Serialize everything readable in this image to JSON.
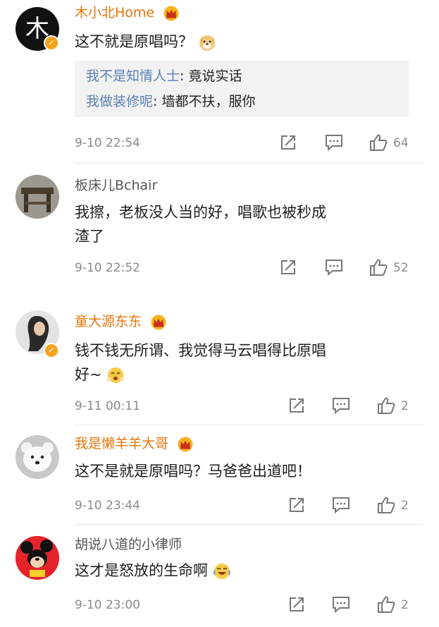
{
  "comments": [
    {
      "username": "木小北Home",
      "vip": true,
      "verified": true,
      "avatar_text": "木",
      "text": "这不就是原唱吗？",
      "emoji": "doge-emoji",
      "replies": [
        {
          "user": "我不是知情人士",
          "text": ": 竟说实话"
        },
        {
          "user": "我做装修呢",
          "text": ": 墙都不扶，服你"
        }
      ],
      "time": "9-10 22:54",
      "likes": "64"
    },
    {
      "username": "板床儿Bchair",
      "vip": false,
      "verified": false,
      "text_lines": [
        "我擦，老板没人当的好，唱歌也被秒成",
        "渣了"
      ],
      "time": "9-10 22:52",
      "likes": "52"
    },
    {
      "username": "童大源东东",
      "vip": true,
      "verified": true,
      "text_lines": [
        "钱不钱无所谓、我觉得马云唱得比原唱",
        "好~"
      ],
      "emoji": "cry-laugh-emoji",
      "time": "9-11 00:11",
      "likes": "2"
    },
    {
      "username": "我是懒羊羊大哥",
      "vip": true,
      "verified": false,
      "text": "这不是就是原唱吗？马爸爸出道吧！",
      "time": "9-10 23:44",
      "likes": "2"
    },
    {
      "username": "胡说八道的小律师",
      "vip": false,
      "verified": false,
      "text": "这才是怒放的生命啊",
      "emoji": "laugh-tears-emoji",
      "time": "9-10 23:00",
      "likes": "2"
    }
  ],
  "icons": {
    "repost": "repost-icon",
    "comment": "comment-icon",
    "like": "thumbs-up-icon",
    "crown": "vip-crown-icon",
    "verified": "verified-badge-icon"
  },
  "colors": {
    "vip_name": "#e8750a",
    "reply_user": "#5b7fb5",
    "meta_gray": "#8a8a8a",
    "reply_bg": "#f2f2f2"
  }
}
